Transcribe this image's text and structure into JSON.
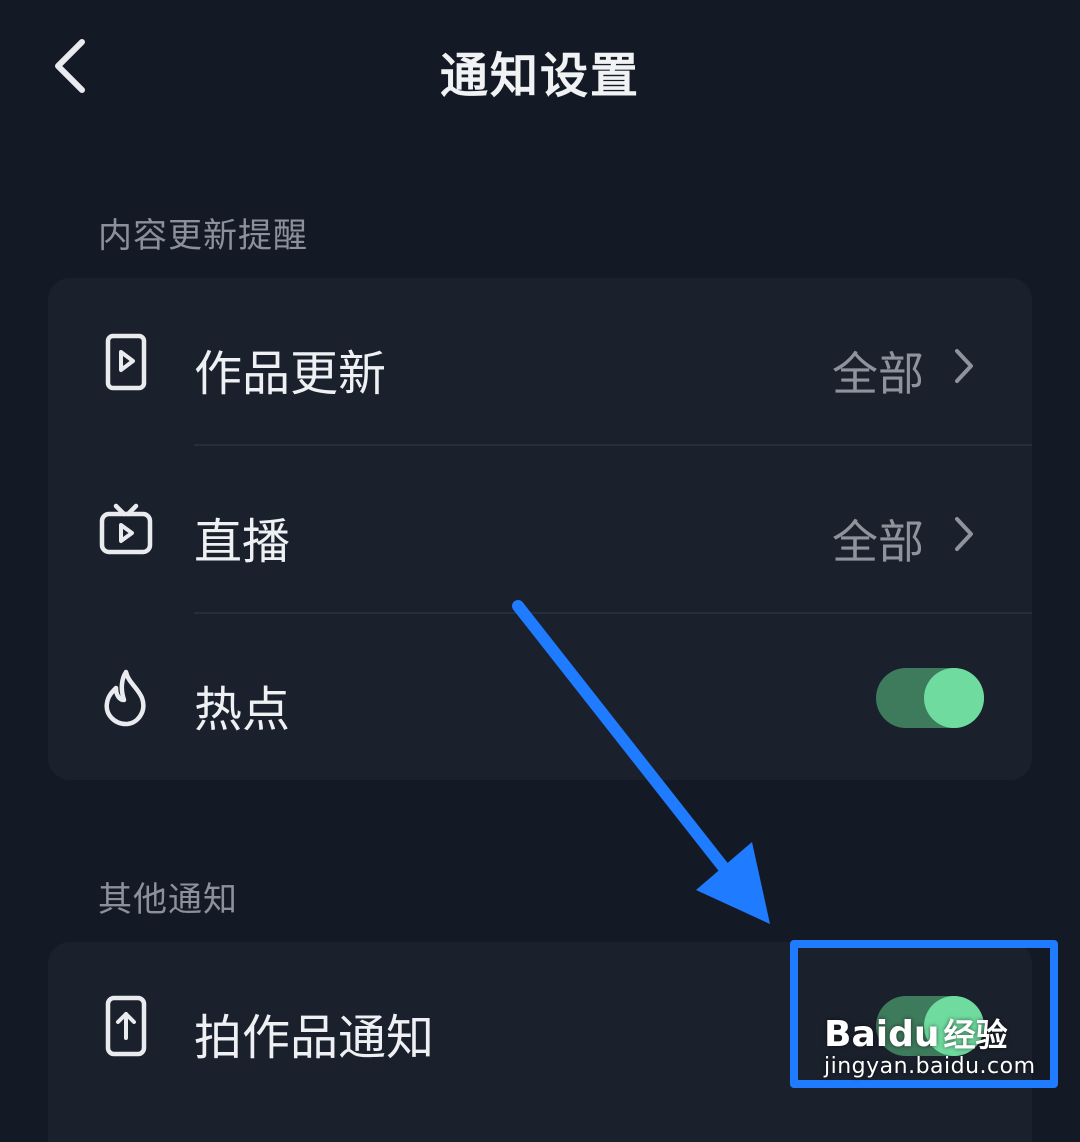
{
  "header": {
    "title": "通知设置"
  },
  "sections": [
    {
      "label": "内容更新提醒",
      "items": [
        {
          "label": "作品更新",
          "value": "全部",
          "icon": "video-file-icon",
          "control": "chevron"
        },
        {
          "label": "直播",
          "value": "全部",
          "icon": "tv-play-icon",
          "control": "chevron"
        },
        {
          "label": "热点",
          "icon": "flame-icon",
          "control": "toggle",
          "on": true
        }
      ]
    },
    {
      "label": "其他通知",
      "items": [
        {
          "label": "拍作品通知",
          "icon": "phone-upload-icon",
          "control": "toggle",
          "on": true
        }
      ]
    }
  ],
  "watermark": {
    "brand": "Baidu",
    "cn": "经验",
    "url": "jingyan.baidu.com"
  },
  "colors": {
    "background": "#141a25",
    "card": "#1b212c",
    "toggle_track": "#3e7a5c",
    "toggle_knob": "#6fdb9e",
    "highlight": "#1f7bff"
  }
}
